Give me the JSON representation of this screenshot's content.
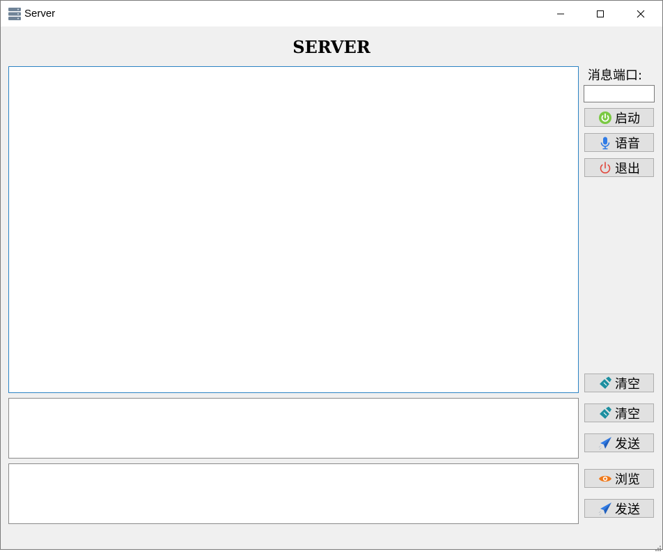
{
  "window": {
    "title": "Server",
    "app_icon": "server-icon"
  },
  "controls": {
    "minimize": "minimize-icon",
    "maximize": "maximize-icon",
    "close": "close-icon"
  },
  "heading": "SERVER",
  "sidebar": {
    "port_label": "消息端口:",
    "port_value": "",
    "start_label": "启动",
    "voice_label": "语音",
    "exit_label": "退出",
    "clear_log_label": "清空"
  },
  "message_panel": {
    "clear_label": "清空",
    "send_label": "发送"
  },
  "file_panel": {
    "browse_label": "浏览",
    "send_label": "发送"
  },
  "colors": {
    "log_border": "#2b82c3",
    "start": "#7ac943",
    "voice": "#2f7be6",
    "exit": "#e0473c",
    "clear": "#1c8fa0",
    "send": "#2f7be6",
    "browse": "#f07818"
  }
}
